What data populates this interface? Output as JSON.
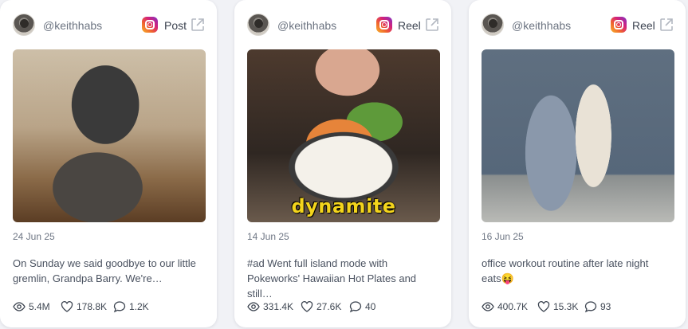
{
  "cards": [
    {
      "handle": "@keithhabs",
      "platform_icon": "instagram-icon",
      "type": "Post",
      "date": "24 Jun 25",
      "caption_line1": "On Sunday we said goodbye to our little",
      "caption_line2": "gremlin, Grandpa Barry. We're…",
      "views": "5.4M",
      "likes": "178.8K",
      "comments": "1.2K"
    },
    {
      "handle": "@keithhabs",
      "platform_icon": "instagram-icon",
      "type": "Reel",
      "overlay": "dynamite",
      "date": "14 Jun 25",
      "caption_line1": "#ad Went full island mode with",
      "caption_line2": "Pokeworks' Hawaiian Hot Plates and still…",
      "views": "331.4K",
      "likes": "27.6K",
      "comments": "40"
    },
    {
      "handle": "@keithhabs",
      "platform_icon": "instagram-icon",
      "type": "Reel",
      "date": "16 Jun 25",
      "caption_line1": "office workout routine after late night",
      "caption_line2": "eats😝",
      "views": "400.7K",
      "likes": "15.3K",
      "comments": "93"
    }
  ],
  "colors": {
    "background": "#f1f2f6",
    "card": "#ffffff",
    "handle_text": "#6b7380",
    "overlay_text": "#f3d41c"
  }
}
